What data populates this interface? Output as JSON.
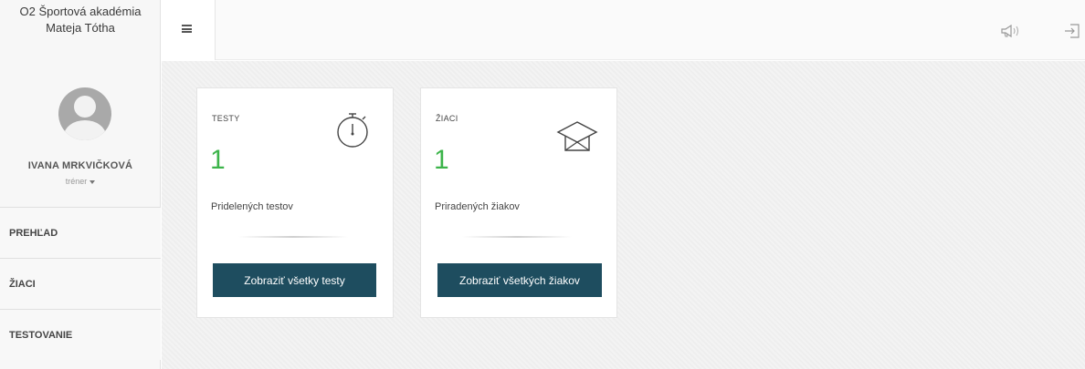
{
  "sidebar": {
    "org_title": "O2 Športová akadémia Mateja Tótha",
    "user": {
      "name": "IVANA MRKVIČKOVÁ",
      "role": "tréner"
    },
    "nav": [
      {
        "label": "PREHĽAD"
      },
      {
        "label": "ŽIACI"
      },
      {
        "label": "TESTOVANIE"
      }
    ]
  },
  "header": {
    "icons": [
      "menu-icon",
      "megaphone-icon",
      "logout-icon"
    ]
  },
  "cards": {
    "tests": {
      "title": "TESTY",
      "count": "1",
      "subtitle": "Pridelených testov",
      "button": "Zobraziť všetky testy",
      "icon": "stopwatch-icon"
    },
    "students": {
      "title": "ŽIACI",
      "count": "1",
      "subtitle": "Priradených žiakov",
      "button": "Zobraziť všetkých žiakov",
      "icon": "graduation-cap-icon"
    }
  },
  "colors": {
    "accent_green": "#3cb44a",
    "button_bg": "#1e4d5f"
  }
}
